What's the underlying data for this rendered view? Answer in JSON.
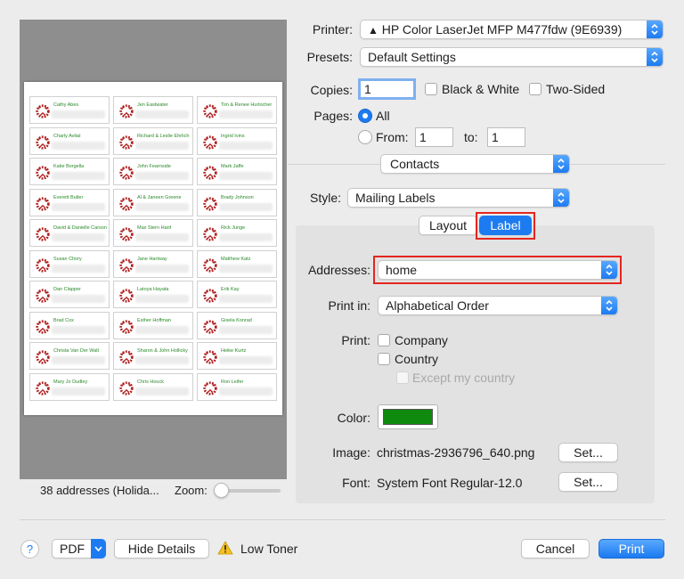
{
  "preview": {
    "summary": "38 addresses (Holida...",
    "zoom_label": "Zoom:",
    "labels": [
      "Cathy Abes",
      "Jen Eastwater",
      "Tim & Renee Hurlocher",
      "Charly Avital",
      "Richard & Leslie Ehrlich",
      "Ingrid Ivins",
      "Katie Borgella",
      "John Fearnside",
      "Mark Jaffe",
      "Everett Butler",
      "Al & Janeen Greene",
      "Brady Johnson",
      "David & Danielle Carson",
      "Max Stern Hanf",
      "Rick Junge",
      "Susan Chory",
      "Jane Hartway",
      "Matthew Katz",
      "Dan Clapper",
      "Latoya Hayata",
      "Erik Kay",
      "Brad Cox",
      "Esther Hoffman",
      "Gisela Konrad",
      "Christa Van Der Walt",
      "Sharon & John Hollicky",
      "Heike Kurtz",
      "Mary Jo Dudley",
      "Chris Houck",
      "Ron Leifer"
    ]
  },
  "printer": {
    "label": "Printer:",
    "value": "HP Color LaserJet MFP M477fdw (9E6939)",
    "warning_icon": "warning-triangle-icon"
  },
  "presets": {
    "label": "Presets:",
    "value": "Default Settings"
  },
  "copies": {
    "label": "Copies:",
    "value": "1",
    "bw_label": "Black & White",
    "two_sided_label": "Two-Sided"
  },
  "pages": {
    "label": "Pages:",
    "all_label": "All",
    "from_label": "From:",
    "from_value": "1",
    "to_label": "to:",
    "to_value": "1"
  },
  "section": {
    "value": "Contacts"
  },
  "style": {
    "label": "Style:",
    "value": "Mailing Labels"
  },
  "tabs": {
    "layout": "Layout",
    "label": "Label"
  },
  "addresses": {
    "label": "Addresses:",
    "value": "home"
  },
  "print_in": {
    "label": "Print in:",
    "value": "Alphabetical Order"
  },
  "print": {
    "label": "Print:",
    "company": "Company",
    "country": "Country",
    "except": "Except my country"
  },
  "color": {
    "label": "Color:",
    "swatch": "#0f8a0f"
  },
  "image": {
    "label": "Image:",
    "value": "christmas-2936796_640.png",
    "set": "Set..."
  },
  "font": {
    "label": "Font:",
    "value": "System Font Regular-12.0",
    "set": "Set..."
  },
  "footer": {
    "help": "?",
    "pdf": "PDF",
    "hide_details": "Hide Details",
    "low_toner": "Low Toner",
    "cancel": "Cancel",
    "print": "Print"
  },
  "colors": {
    "accent": "#1d7bf2",
    "highlight": "#e4261f",
    "label_text": "#2a8a2a"
  }
}
